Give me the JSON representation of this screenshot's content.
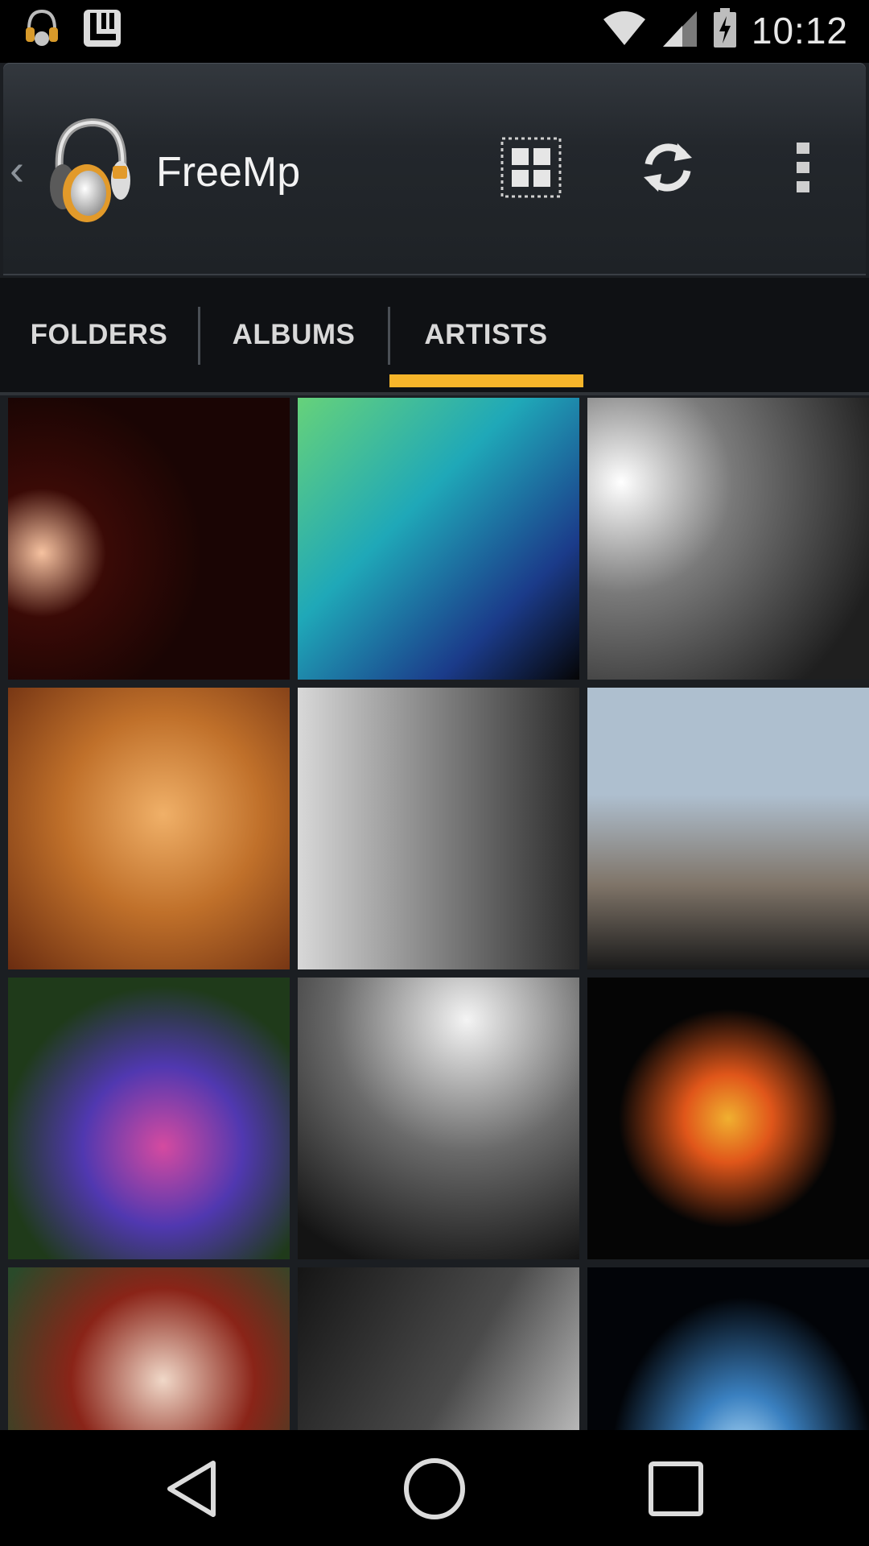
{
  "status_bar": {
    "time": "10:12",
    "icons": [
      "headphones-notification-icon",
      "app-notification-icon",
      "wifi-icon",
      "cell-signal-icon",
      "battery-charging-icon"
    ]
  },
  "action_bar": {
    "title": "FreeMp",
    "actions": [
      "grid-view-icon",
      "refresh-icon",
      "overflow-menu-icon"
    ]
  },
  "tabs": [
    {
      "label": "FOLDERS",
      "selected": false
    },
    {
      "label": "ALBUMS",
      "selected": false
    },
    {
      "label": "ARTISTS",
      "selected": true
    }
  ],
  "colors": {
    "accent": "#f6b52a",
    "tab_bar_bg": "#0f1114",
    "action_bar_bg": "#23272c"
  },
  "artist_tiles": [
    {
      "name": "artist-tile-1",
      "palette": [
        "#1a0504",
        "#f6c2a0",
        "#3a0a06"
      ]
    },
    {
      "name": "artist-tile-2",
      "palette": [
        "#1fa8b8",
        "#1b3b8a",
        "#66d27a"
      ]
    },
    {
      "name": "artist-tile-3",
      "palette": [
        "#ffffff",
        "#7a7a7a",
        "#1f1f1f"
      ]
    },
    {
      "name": "artist-tile-4",
      "palette": [
        "#f0b068",
        "#c0702a",
        "#6a2c10"
      ]
    },
    {
      "name": "artist-tile-5",
      "palette": [
        "#d8d8d8",
        "#8a8a8a",
        "#2a2a2a"
      ]
    },
    {
      "name": "artist-tile-6",
      "palette": [
        "#aebfcf",
        "#7f7468",
        "#1a1a1a"
      ]
    },
    {
      "name": "artist-tile-7",
      "palette": [
        "#1f3a1a",
        "#d54aa0",
        "#5038b0"
      ]
    },
    {
      "name": "artist-tile-8",
      "palette": [
        "#f4f4f4",
        "#6a6a6a",
        "#141414"
      ]
    },
    {
      "name": "artist-tile-9",
      "palette": [
        "#050505",
        "#e0561a",
        "#f0b030"
      ]
    },
    {
      "name": "artist-tile-10",
      "palette": [
        "#2a4a2a",
        "#f0d8c8",
        "#8a2418"
      ]
    },
    {
      "name": "artist-tile-11",
      "palette": [
        "#e8e8e8",
        "#4a4a4a",
        "#151515"
      ]
    },
    {
      "name": "artist-tile-12",
      "palette": [
        "#020408",
        "#3a80c0",
        "#bfe6ff"
      ]
    }
  ],
  "nav_bar": [
    "back-icon",
    "home-icon",
    "recents-icon"
  ]
}
